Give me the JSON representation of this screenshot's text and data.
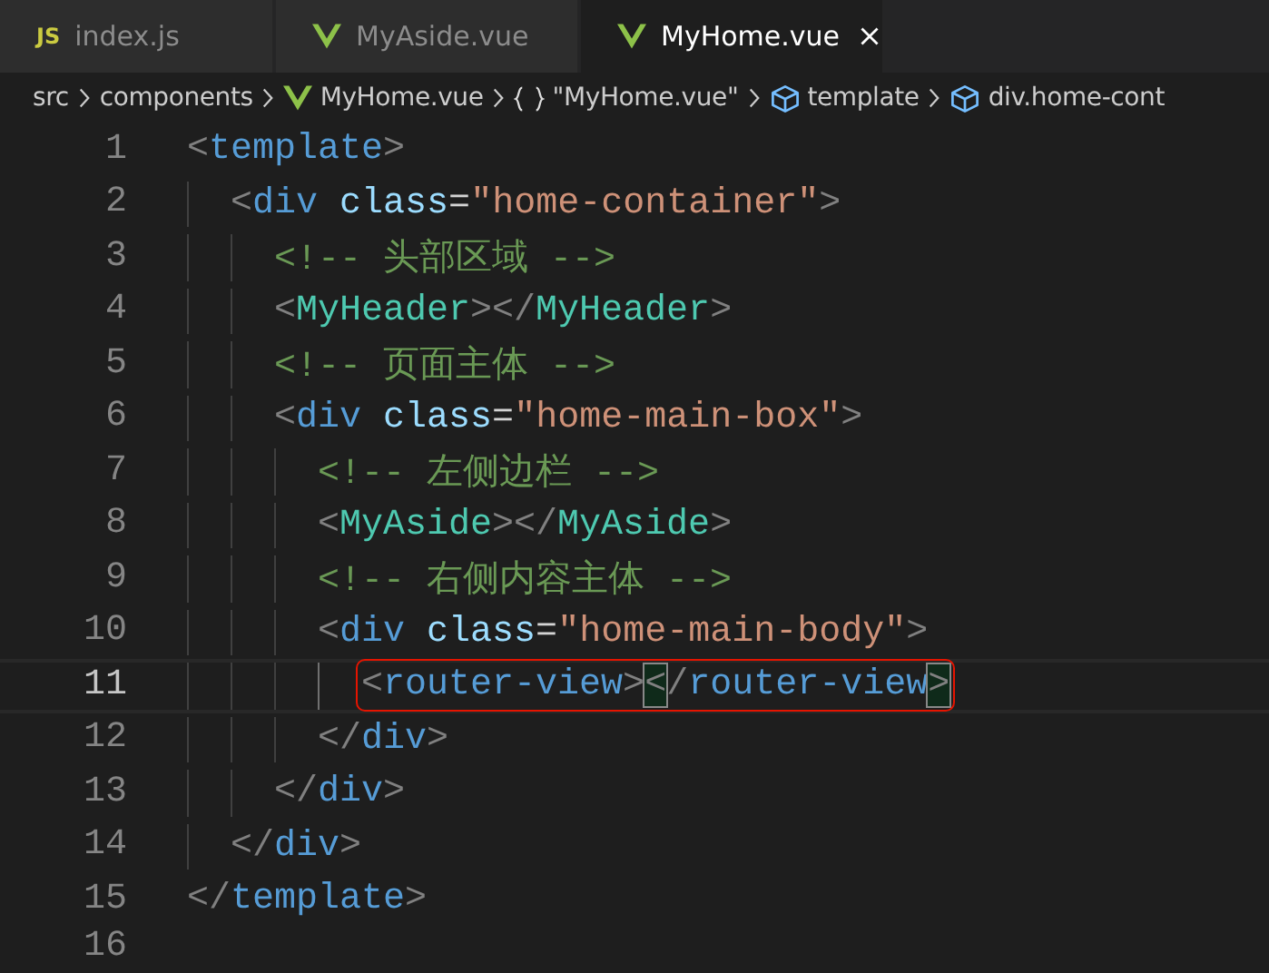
{
  "tabs": [
    {
      "label": "index.js",
      "kind": "js",
      "icon_text": "JS",
      "selected": false,
      "closable": false
    },
    {
      "label": "MyAside.vue",
      "kind": "vue",
      "selected": false,
      "closable": false
    },
    {
      "label": "MyHome.vue",
      "kind": "vue",
      "selected": true,
      "closable": true
    }
  ],
  "breadcrumb": [
    {
      "label": "src",
      "kind": "folder"
    },
    {
      "label": "components",
      "kind": "folder"
    },
    {
      "label": "MyHome.vue",
      "kind": "vue"
    },
    {
      "label": "\"MyHome.vue\"",
      "kind": "object"
    },
    {
      "label": "template",
      "kind": "element"
    },
    {
      "label": "div.home-cont",
      "kind": "element"
    }
  ],
  "lines": [
    {
      "number": "1",
      "selected": false,
      "tokens": [
        {
          "kind": "punct",
          "text": "<"
        },
        {
          "kind": "tag",
          "text": "template"
        },
        {
          "kind": "punct",
          "text": ">"
        }
      ],
      "children": [
        {
          "number": "2",
          "selected": false,
          "tokens": [
            {
              "kind": "punct",
              "text": "<"
            },
            {
              "kind": "tag",
              "text": "div"
            },
            {
              "kind": "attr",
              "text": " class"
            },
            {
              "kind": "text",
              "text": "="
            },
            {
              "kind": "string",
              "text": "\"home-container\""
            },
            {
              "kind": "punct",
              "text": ">"
            }
          ],
          "children": [
            {
              "number": "3",
              "selected": false,
              "tokens": [
                {
                  "kind": "comment",
                  "text": "<!-- 头部区域 -->"
                }
              ]
            },
            {
              "number": "4",
              "selected": false,
              "tokens": [
                {
                  "kind": "punct",
                  "text": "<"
                },
                {
                  "kind": "component",
                  "text": "MyHeader"
                },
                {
                  "kind": "punct",
                  "text": "></"
                },
                {
                  "kind": "component",
                  "text": "MyHeader"
                },
                {
                  "kind": "punct",
                  "text": ">"
                }
              ]
            },
            {
              "number": "5",
              "selected": false,
              "tokens": [
                {
                  "kind": "comment",
                  "text": "<!-- 页面主体 -->"
                }
              ]
            },
            {
              "number": "6",
              "selected": false,
              "tokens": [
                {
                  "kind": "punct",
                  "text": "<"
                },
                {
                  "kind": "tag",
                  "text": "div"
                },
                {
                  "kind": "attr",
                  "text": " class"
                },
                {
                  "kind": "text",
                  "text": "="
                },
                {
                  "kind": "string",
                  "text": "\"home-main-box\""
                },
                {
                  "kind": "punct",
                  "text": ">"
                }
              ],
              "children": [
                {
                  "number": "7",
                  "selected": false,
                  "tokens": [
                    {
                      "kind": "comment",
                      "text": "<!-- 左侧边栏 -->"
                    }
                  ]
                },
                {
                  "number": "8",
                  "selected": false,
                  "tokens": [
                    {
                      "kind": "punct",
                      "text": "<"
                    },
                    {
                      "kind": "component",
                      "text": "MyAside"
                    },
                    {
                      "kind": "punct",
                      "text": "></"
                    },
                    {
                      "kind": "component",
                      "text": "MyAside"
                    },
                    {
                      "kind": "punct",
                      "text": ">"
                    }
                  ]
                },
                {
                  "number": "9",
                  "selected": false,
                  "tokens": [
                    {
                      "kind": "comment",
                      "text": "<!-- 右侧内容主体 -->"
                    }
                  ]
                },
                {
                  "number": "10",
                  "selected": false,
                  "tokens": [
                    {
                      "kind": "punct",
                      "text": "<"
                    },
                    {
                      "kind": "tag",
                      "text": "div"
                    },
                    {
                      "kind": "attr",
                      "text": " class"
                    },
                    {
                      "kind": "text",
                      "text": "="
                    },
                    {
                      "kind": "string",
                      "text": "\"home-main-body\""
                    },
                    {
                      "kind": "punct",
                      "text": ">"
                    }
                  ],
                  "children": [
                    {
                      "number": "11",
                      "selected": true,
                      "boxed": true,
                      "tokens": [
                        {
                          "kind": "punct",
                          "text": "<",
                          "matched": false
                        },
                        {
                          "kind": "tag",
                          "text": "router-view",
                          "matched": false
                        },
                        {
                          "kind": "punct",
                          "text": ">",
                          "matched": false
                        },
                        {
                          "kind": "punct",
                          "text": "<",
                          "matched": true
                        },
                        {
                          "kind": "punct",
                          "text": "/",
                          "matched": false
                        },
                        {
                          "kind": "tag",
                          "text": "router-view",
                          "matched": false
                        },
                        {
                          "kind": "punct",
                          "text": ">",
                          "matched": true
                        }
                      ]
                    }
                  ]
                },
                {
                  "number": "12",
                  "selected": false,
                  "tokens": [
                    {
                      "kind": "punct",
                      "text": "</"
                    },
                    {
                      "kind": "tag",
                      "text": "div"
                    },
                    {
                      "kind": "punct",
                      "text": ">"
                    }
                  ]
                }
              ]
            },
            {
              "number": "13",
              "selected": false,
              "tokens": [
                {
                  "kind": "punct",
                  "text": "</"
                },
                {
                  "kind": "tag",
                  "text": "div"
                },
                {
                  "kind": "punct",
                  "text": ">"
                }
              ]
            }
          ]
        },
        {
          "number": "14",
          "selected": false,
          "tokens": [
            {
              "kind": "punct",
              "text": "</"
            },
            {
              "kind": "tag",
              "text": "div"
            },
            {
              "kind": "punct",
              "text": ">"
            }
          ]
        }
      ]
    },
    {
      "number": "15",
      "selected": false,
      "tokens": [
        {
          "kind": "punct",
          "text": "</"
        },
        {
          "kind": "tag",
          "text": "template"
        },
        {
          "kind": "punct",
          "text": ">"
        }
      ]
    },
    {
      "number": "16",
      "selected": false
    }
  ]
}
